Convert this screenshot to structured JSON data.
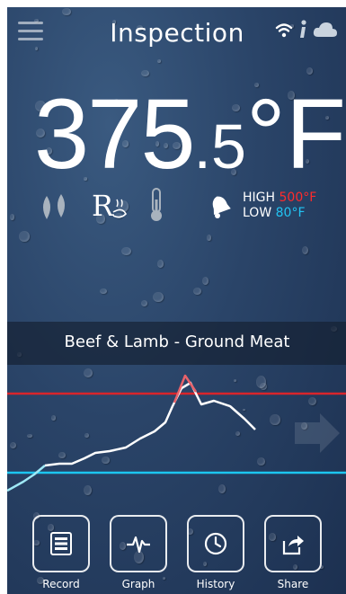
{
  "header": {
    "title": "Inspection",
    "menu_icon": "hamburger-menu-icon",
    "wifi_icon": "wifi-icon",
    "info_icon": "info-icon",
    "cloud_icon": "cloud-icon"
  },
  "reading": {
    "value_main": "375",
    "value_decimal": ".5",
    "unit": "°F"
  },
  "status_icons": [
    "humidity-drops-icon",
    "recipe-icon",
    "thermometer-icon"
  ],
  "alarm": {
    "icon": "alarm-bell-icon",
    "high_label": "HIGH",
    "high_value": "500°F",
    "low_label": "LOW",
    "low_value": "80°F",
    "high_color": "#ff2b2b",
    "low_color": "#22c3f2"
  },
  "food": {
    "name": "Beef & Lamb - Ground Meat"
  },
  "graph": {
    "high_line_color": "#d9252b",
    "low_line_color": "#1cc6f0",
    "trend_color": "#ffffff",
    "start_segment_color": "#9ee8f5",
    "next_icon": "arrow-right-icon"
  },
  "actions": [
    {
      "label": "Record",
      "icon": "record-icon"
    },
    {
      "label": "Graph",
      "icon": "graph-pulse-icon"
    },
    {
      "label": "History",
      "icon": "clock-icon"
    },
    {
      "label": "Share",
      "icon": "share-icon"
    }
  ]
}
